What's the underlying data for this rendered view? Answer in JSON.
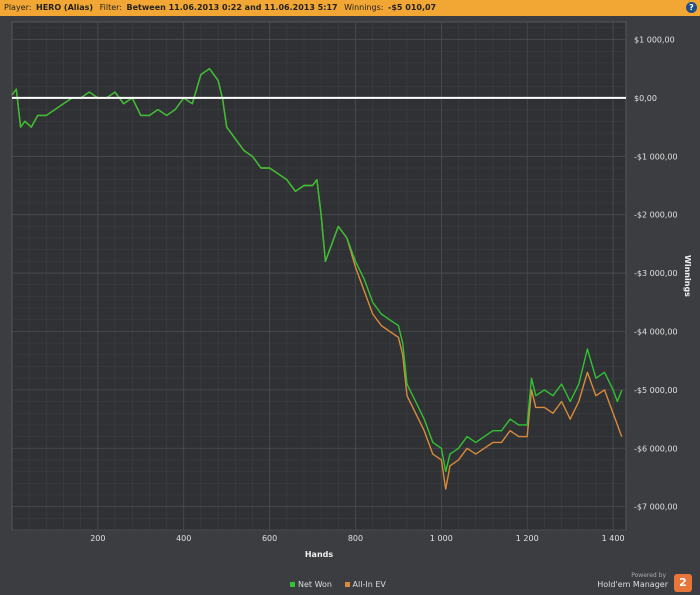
{
  "header": {
    "player_label": "Player:",
    "player_value": "HERO (Alias)",
    "filter_label": "Filter:",
    "filter_value": "Between 11.06.2013 0:22 and 11.06.2013 5:17",
    "winnings_label": "Winnings:",
    "winnings_value": "-$5 010,07",
    "help_glyph": "?"
  },
  "colors": {
    "background": "#3b3d40",
    "plot_background": "#2f3134",
    "header_bg": "#f2a633",
    "net_won": "#33c233",
    "all_in_ev": "#d98a3a",
    "zero_line": "#ffffff"
  },
  "branding": {
    "powered_by": "Powered by",
    "name": "Hold'em Manager",
    "logo_glyph": "2"
  },
  "chart_data": {
    "type": "line",
    "xlabel": "Hands",
    "ylabel": "Winnings",
    "xlim": [
      0,
      1430
    ],
    "ylim": [
      -7400,
      1300
    ],
    "x_ticks": [
      200,
      400,
      600,
      800,
      1000,
      1200,
      1400
    ],
    "x_tick_labels": [
      "200",
      "400",
      "600",
      "800",
      "1 000",
      "1 200",
      "1 400"
    ],
    "y_ticks": [
      1000,
      0,
      -1000,
      -2000,
      -3000,
      -4000,
      -5000,
      -6000,
      -7000
    ],
    "y_tick_labels": [
      "$1 000,00",
      "$0,00",
      "-$1 000,00",
      "-$2 000,00",
      "-$3 000,00",
      "-$4 000,00",
      "-$5 000,00",
      "-$6 000,00",
      "-$7 000,00"
    ],
    "grid": true,
    "zero_line": 0,
    "legend_position": "bottom-center",
    "series": [
      {
        "name": "Net Won",
        "x": [
          0,
          10,
          20,
          30,
          45,
          60,
          80,
          100,
          120,
          140,
          160,
          180,
          200,
          220,
          240,
          260,
          280,
          300,
          320,
          340,
          360,
          380,
          400,
          420,
          440,
          460,
          480,
          490,
          500,
          520,
          540,
          560,
          580,
          600,
          620,
          640,
          660,
          680,
          700,
          710,
          720,
          730,
          740,
          760,
          780,
          800,
          820,
          840,
          860,
          880,
          900,
          910,
          920,
          940,
          960,
          980,
          1000,
          1010,
          1020,
          1040,
          1060,
          1080,
          1100,
          1120,
          1140,
          1160,
          1180,
          1200,
          1210,
          1220,
          1240,
          1260,
          1280,
          1300,
          1320,
          1340,
          1360,
          1380,
          1400,
          1410,
          1420
        ],
        "y": [
          50,
          150,
          -500,
          -400,
          -500,
          -300,
          -300,
          -200,
          -100,
          0,
          0,
          100,
          0,
          0,
          100,
          -100,
          0,
          -300,
          -300,
          -200,
          -300,
          -200,
          0,
          -100,
          400,
          500,
          300,
          0,
          -500,
          -700,
          -900,
          -1000,
          -1200,
          -1200,
          -1300,
          -1400,
          -1600,
          -1500,
          -1500,
          -1400,
          -2000,
          -2800,
          -2600,
          -2200,
          -2400,
          -2800,
          -3100,
          -3500,
          -3700,
          -3800,
          -3900,
          -4200,
          -4900,
          -5200,
          -5500,
          -5900,
          -6000,
          -6400,
          -6100,
          -6000,
          -5800,
          -5900,
          -5800,
          -5700,
          -5700,
          -5500,
          -5600,
          -5600,
          -4800,
          -5100,
          -5000,
          -5100,
          -4900,
          -5200,
          -4900,
          -4300,
          -4800,
          -4700,
          -5000,
          -5200,
          -5010
        ]
      },
      {
        "name": "All-In EV",
        "x": [
          0,
          10,
          20,
          30,
          45,
          60,
          80,
          100,
          120,
          140,
          160,
          180,
          200,
          220,
          240,
          260,
          280,
          300,
          320,
          340,
          360,
          380,
          400,
          420,
          440,
          460,
          480,
          490,
          500,
          520,
          540,
          560,
          580,
          600,
          620,
          640,
          660,
          680,
          700,
          710,
          720,
          730,
          740,
          760,
          780,
          800,
          820,
          840,
          860,
          880,
          900,
          910,
          920,
          940,
          960,
          980,
          1000,
          1010,
          1020,
          1040,
          1060,
          1080,
          1100,
          1120,
          1140,
          1160,
          1180,
          1200,
          1210,
          1220,
          1240,
          1260,
          1280,
          1300,
          1320,
          1340,
          1360,
          1380,
          1400,
          1410,
          1420
        ],
        "y": [
          50,
          150,
          -500,
          -400,
          -500,
          -300,
          -300,
          -200,
          -100,
          0,
          0,
          100,
          0,
          0,
          100,
          -100,
          0,
          -300,
          -300,
          -200,
          -300,
          -200,
          0,
          -100,
          400,
          500,
          300,
          0,
          -500,
          -700,
          -900,
          -1000,
          -1200,
          -1200,
          -1300,
          -1400,
          -1600,
          -1500,
          -1500,
          -1400,
          -2000,
          -2800,
          -2600,
          -2200,
          -2400,
          -2900,
          -3300,
          -3700,
          -3900,
          -4000,
          -4100,
          -4400,
          -5100,
          -5400,
          -5700,
          -6100,
          -6200,
          -6700,
          -6300,
          -6200,
          -6000,
          -6100,
          -6000,
          -5900,
          -5900,
          -5700,
          -5800,
          -5800,
          -5000,
          -5300,
          -5300,
          -5400,
          -5200,
          -5500,
          -5200,
          -4700,
          -5100,
          -5000,
          -5400,
          -5600,
          -5800
        ]
      }
    ]
  }
}
